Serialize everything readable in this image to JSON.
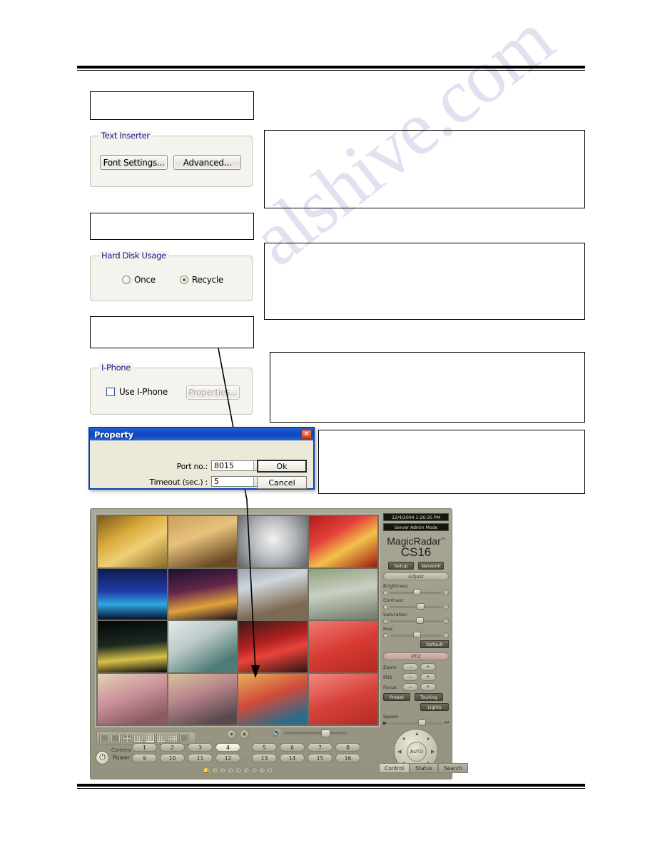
{
  "watermark": {
    "text": "alshive.com"
  },
  "callouts": [
    {
      "name": "callout-top-left",
      "text": ""
    },
    {
      "name": "callout-text-inserter",
      "text": ""
    },
    {
      "name": "callout-mid-left",
      "text": ""
    },
    {
      "name": "callout-hard-disk",
      "text": ""
    },
    {
      "name": "callout-lower-left",
      "text": ""
    },
    {
      "name": "callout-iphone",
      "text": ""
    },
    {
      "name": "callout-property",
      "text": ""
    }
  ],
  "text_inserter": {
    "legend": "Text Inserter",
    "font_settings_label": "Font Settings...",
    "advanced_label": "Advanced..."
  },
  "hard_disk": {
    "legend": "Hard Disk Usage",
    "options": [
      {
        "label": "Once",
        "selected": false
      },
      {
        "label": "Recycle",
        "selected": true
      }
    ]
  },
  "iphone": {
    "legend": "I-Phone",
    "checkbox_label": "Use I-Phone",
    "checked": false,
    "properties_label": "Properties...",
    "properties_disabled": true
  },
  "property_dialog": {
    "title": "Property",
    "close_glyph": "✕",
    "fields": [
      {
        "label": "Port no.:",
        "value": "8015"
      },
      {
        "label": "Timeout (sec.) :",
        "value": "5"
      }
    ],
    "ok_label": "Ok",
    "cancel_label": "Cancel"
  },
  "dvr": {
    "status_time": "12/4/2004 1:26:35 PM",
    "status_mode": "Server Admin Mode",
    "brand_name": "MagicRadar",
    "brand_tm": "™",
    "brand_model": "CS16",
    "setup_label": "Setup",
    "network_label": "Network",
    "adjust_header": "Adjust",
    "adjust_sliders": [
      {
        "label": "Brightness",
        "pct": 45
      },
      {
        "label": "Contrast",
        "pct": 52
      },
      {
        "label": "Saturation",
        "pct": 50
      },
      {
        "label": "Hue",
        "pct": 45
      }
    ],
    "default_label": "Default",
    "ptz_header": "PTZ",
    "ptz_rows": [
      {
        "label": "Zoom",
        "minus": "–",
        "plus": "+"
      },
      {
        "label": "IRIS",
        "minus": "–",
        "plus": "+"
      },
      {
        "label": "Focus",
        "minus": "–",
        "plus": "+"
      }
    ],
    "preset_label": "Preset",
    "touring_label": "Touring",
    "lights_label": "Lights",
    "speed_label": "Speed",
    "speed_pct": 55,
    "auto_label": "AUTO",
    "tabs": [
      {
        "label": "Control",
        "active": true
      },
      {
        "label": "Status",
        "active": false
      },
      {
        "label": "Search",
        "active": false
      }
    ],
    "camera_label": "Camera",
    "camera_buttons": [
      "1",
      "2",
      "3",
      "4",
      "5",
      "6",
      "7",
      "8",
      "9",
      "10",
      "11",
      "12",
      "13",
      "14",
      "15",
      "16"
    ],
    "camera_active": "4",
    "power_label": "Power",
    "power_glyph": "⏻",
    "alarm_indicators": [
      "1",
      "2",
      "3",
      "4",
      "5",
      "6",
      "7",
      "8"
    ],
    "layout_views": [
      {
        "name": "layout-auto-sequence",
        "cols": 1,
        "rows": 1,
        "selected": false
      },
      {
        "name": "layout-1-view",
        "cols": 1,
        "rows": 1,
        "selected": false
      },
      {
        "name": "layout-4-view",
        "cols": 2,
        "rows": 2,
        "selected": false
      },
      {
        "name": "layout-6-view",
        "cols": 3,
        "rows": 3,
        "selected": false
      },
      {
        "name": "layout-9-view",
        "cols": 3,
        "rows": 3,
        "selected": true
      },
      {
        "name": "layout-10-view",
        "cols": 4,
        "rows": 3,
        "selected": false
      },
      {
        "name": "layout-16-view",
        "cols": 4,
        "rows": 4,
        "selected": false
      },
      {
        "name": "layout-full-screen",
        "cols": 1,
        "rows": 1,
        "selected": false
      }
    ],
    "video_cells": [
      {
        "name": "camera-cell-1",
        "scene": "hotel-lobby-gold"
      },
      {
        "name": "camera-cell-2",
        "scene": "office-interior-warm"
      },
      {
        "name": "camera-cell-3",
        "scene": "atrium-dome-ceiling"
      },
      {
        "name": "camera-cell-4",
        "scene": "red-festival-decor"
      },
      {
        "name": "camera-cell-5",
        "scene": "harbour-night-blue"
      },
      {
        "name": "camera-cell-6",
        "scene": "city-night-aerial"
      },
      {
        "name": "camera-cell-7",
        "scene": "crowded-hall-daylight"
      },
      {
        "name": "camera-cell-8",
        "scene": "race-track-wet"
      },
      {
        "name": "camera-cell-9",
        "scene": "skyline-night-dark"
      },
      {
        "name": "camera-cell-10",
        "scene": "auditorium-seats-white"
      },
      {
        "name": "camera-cell-11",
        "scene": "race-cars-red"
      },
      {
        "name": "camera-cell-12",
        "scene": "red-corridor-curve"
      },
      {
        "name": "camera-cell-13",
        "scene": "waiting-area-seats"
      },
      {
        "name": "camera-cell-14",
        "scene": "bank-queue-people"
      },
      {
        "name": "camera-cell-15",
        "scene": "mall-walkway-crowd"
      },
      {
        "name": "camera-cell-16",
        "scene": "red-stairs-display"
      }
    ]
  }
}
